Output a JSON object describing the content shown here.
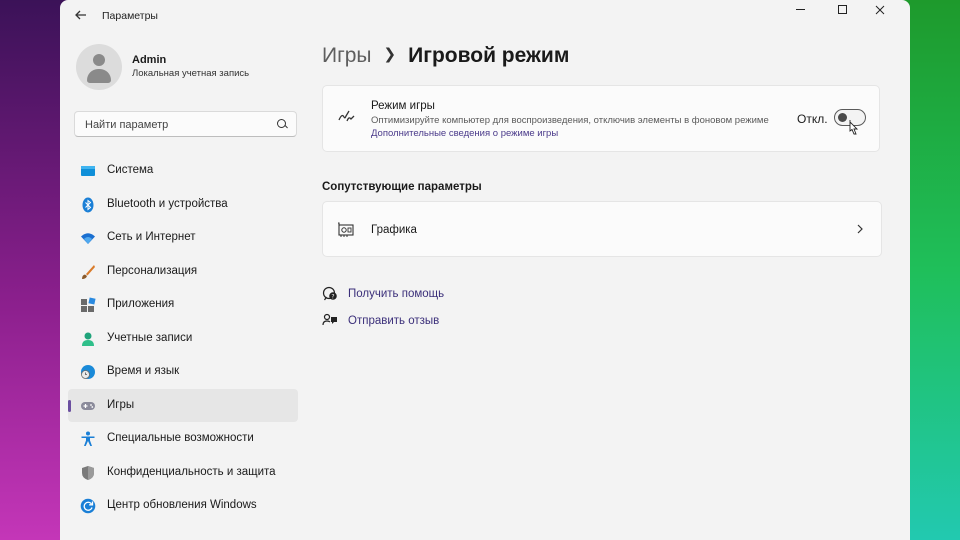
{
  "window": {
    "title": "Параметры"
  },
  "profile": {
    "name": "Admin",
    "role": "Локальная учетная запись"
  },
  "search": {
    "placeholder": "Найти параметр"
  },
  "sidebar": {
    "items": [
      {
        "label": "Система",
        "icon": "system-icon"
      },
      {
        "label": "Bluetooth и устройства",
        "icon": "bluetooth-icon"
      },
      {
        "label": "Сеть и Интернет",
        "icon": "wifi-icon"
      },
      {
        "label": "Персонализация",
        "icon": "brush-icon"
      },
      {
        "label": "Приложения",
        "icon": "apps-icon"
      },
      {
        "label": "Учетные записи",
        "icon": "account-icon"
      },
      {
        "label": "Время и язык",
        "icon": "globe-clock-icon"
      },
      {
        "label": "Игры",
        "icon": "gamepad-icon",
        "active": true
      },
      {
        "label": "Специальные возможности",
        "icon": "accessibility-icon"
      },
      {
        "label": "Конфиденциальность и защита",
        "icon": "shield-icon"
      },
      {
        "label": "Центр обновления Windows",
        "icon": "update-icon"
      }
    ]
  },
  "breadcrumb": {
    "parent": "Игры",
    "current": "Игровой режим"
  },
  "game_mode": {
    "title": "Режим игры",
    "description": "Оптимизируйте компьютер для воспроизведения, отключив элементы в фоновом режиме",
    "link": "Дополнительные сведения о режиме игры",
    "state_label": "Откл.",
    "enabled": false
  },
  "related": {
    "heading": "Сопутствующие параметры",
    "items": [
      {
        "label": "Графика",
        "icon": "graphics-card-icon"
      }
    ]
  },
  "help_links": [
    {
      "label": "Получить помощь",
      "icon": "help-icon"
    },
    {
      "label": "Отправить отзыв",
      "icon": "feedback-icon"
    }
  ],
  "colors": {
    "accent": "#6b4fa0",
    "link": "#3b2f7a"
  }
}
